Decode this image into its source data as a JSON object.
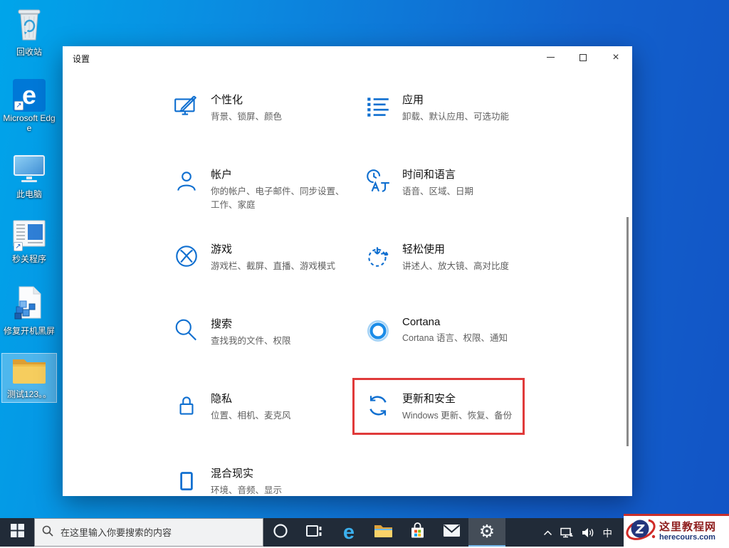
{
  "window": {
    "title": "设置",
    "controls": {
      "minimize": "minimize",
      "maximize": "maximize",
      "close": "×"
    },
    "items": [
      {
        "id": "personalization",
        "title": "个性化",
        "subtitle": "背景、锁屏、颜色"
      },
      {
        "id": "apps",
        "title": "应用",
        "subtitle": "卸载、默认应用、可选功能"
      },
      {
        "id": "accounts",
        "title": "帐户",
        "subtitle": "你的帐户、电子邮件、同步设置、工作、家庭"
      },
      {
        "id": "time-language",
        "title": "时间和语言",
        "subtitle": "语音、区域、日期"
      },
      {
        "id": "gaming",
        "title": "游戏",
        "subtitle": "游戏栏、截屏、直播、游戏模式"
      },
      {
        "id": "ease-of-access",
        "title": "轻松使用",
        "subtitle": "讲述人、放大镜、高对比度"
      },
      {
        "id": "search",
        "title": "搜索",
        "subtitle": "查找我的文件、权限"
      },
      {
        "id": "cortana",
        "title": "Cortana",
        "subtitle": "Cortana 语言、权限、通知"
      },
      {
        "id": "privacy",
        "title": "隐私",
        "subtitle": "位置、相机、麦克风"
      },
      {
        "id": "update-security",
        "title": "更新和安全",
        "subtitle": "Windows 更新、恢复、备份",
        "highlighted": true
      },
      {
        "id": "mixed-reality",
        "title": "混合现实",
        "subtitle": "环境、音频、显示"
      }
    ]
  },
  "desktop": {
    "icons": [
      {
        "id": "recycle-bin",
        "label": "回收站"
      },
      {
        "id": "edge",
        "label": "Microsoft Edge"
      },
      {
        "id": "this-pc",
        "label": "此电脑"
      },
      {
        "id": "app-shortcut",
        "label": "秒关程序"
      },
      {
        "id": "registry-fix",
        "label": "修复开机黑屏"
      },
      {
        "id": "test-folder",
        "label": "测试123。。",
        "selected": true
      }
    ]
  },
  "taskbar": {
    "search_placeholder": "在这里输入你要搜索的内容",
    "tray": {
      "ime": "中"
    }
  },
  "watermark": {
    "site_name": "这里教程网",
    "site_url": "herecours.com"
  },
  "colors": {
    "accent_blue": "#0078d7",
    "icon_blue": "#0f6fd0",
    "highlight_red": "#e03a3a",
    "taskbar_bg": "#212b38",
    "watermark_red": "#8e1d1d",
    "watermark_navy": "#1c3678"
  }
}
